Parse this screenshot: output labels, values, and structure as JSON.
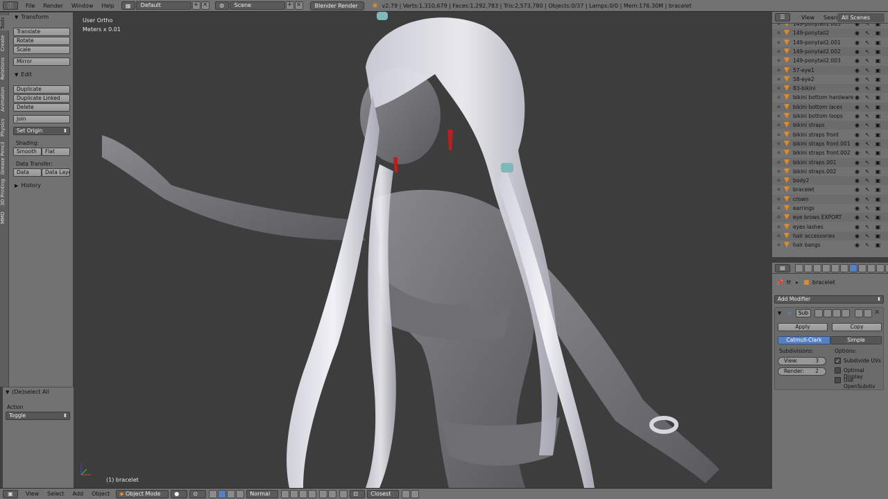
{
  "topbar": {
    "menus": [
      "File",
      "Render",
      "Window",
      "Help"
    ],
    "layout": "Default",
    "scene": "Scene",
    "engine": "Blender Render",
    "stats": "v2.79 | Verts:1,310,679 | Faces:1,292,783 | Tris:2,573,780 | Objects:0/37 | Lamps:0/0 | Mem:176.30M | bracelet"
  },
  "vtabs": [
    "Tools",
    "Create",
    "Relations",
    "Animation",
    "Physics",
    "Grease Pencil",
    "3D Printing",
    "MMD"
  ],
  "toolshelf": {
    "transform": {
      "title": "Transform",
      "buttons": [
        "Translate",
        "Rotate",
        "Scale",
        "Mirror"
      ]
    },
    "edit": {
      "title": "Edit",
      "buttons": [
        "Duplicate",
        "Duplicate Linked",
        "Delete",
        "Join"
      ],
      "set_origin": "Set Origin",
      "shading_label": "Shading:",
      "smooth": "Smooth",
      "flat": "Flat",
      "data_transfer_label": "Data Transfer:",
      "data": "Data",
      "data_layout": "Data Layo"
    },
    "history": "History"
  },
  "operator": {
    "title": "(De)select All",
    "action_label": "Action",
    "action_value": "Toggle"
  },
  "viewport": {
    "view_name": "User Ortho",
    "units": "Meters x 0.01",
    "object_label": "(1) bracelet"
  },
  "bottombar": {
    "menus": [
      "View",
      "Select",
      "Add",
      "Object"
    ],
    "mode": "Object Mode",
    "orientation": "Normal",
    "snap": "Closest"
  },
  "outliner": {
    "tabs": [
      "View",
      "Search",
      "All Scenes"
    ],
    "items": [
      "149-ponytail1.003",
      "149-ponytail2",
      "149-ponytail2.001",
      "149-ponytail2.002",
      "149-ponytail2.003",
      "57-eye1",
      "58-eye2",
      "83-bikini",
      "bikini bottom hardware",
      "bikini bottom laces",
      "bikini bottom loops",
      "bikini straps",
      "bikini straps front",
      "bikini straps front.001",
      "bikini straps front.002",
      "bikini straps.001",
      "bikini straps.002",
      "body2",
      "bracelet",
      "crown",
      "earrings",
      "eye brows EXPORT",
      "eyes lashes",
      "hair accessories",
      "hair bangs"
    ]
  },
  "properties": {
    "object_name": "bracelet",
    "add_modifier": "Add Modifier",
    "modifier_name": "Sub",
    "apply": "Apply",
    "copy": "Copy",
    "catmull": "Catmull-Clark",
    "simple": "Simple",
    "subdivisions_label": "Subdivisions:",
    "options_label": "Options:",
    "view_label": "View:",
    "view_value": "3",
    "render_label": "Render:",
    "render_value": "2",
    "opt1": "Subdivide UVs",
    "opt2": "Optimal Display",
    "opt3": "Use OpenSubdiv"
  },
  "colors": {
    "accent": "#5680c2",
    "panel": "#727272",
    "viewport": "#3d3d3d",
    "orange": "#e08a28"
  }
}
